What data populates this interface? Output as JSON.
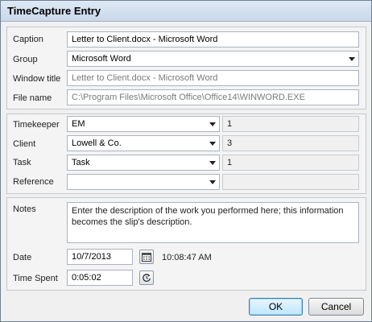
{
  "window": {
    "title": "TimeCapture Entry"
  },
  "info": {
    "caption_label": "Caption",
    "caption_value": "Letter to Client.docx - Microsoft Word",
    "group_label": "Group",
    "group_value": "Microsoft Word",
    "window_title_label": "Window title",
    "window_title_value": "Letter to Client.docx - Microsoft Word",
    "file_name_label": "File name",
    "file_name_value": "C:\\Program Files\\Microsoft Office\\Office14\\WINWORD.EXE"
  },
  "assign": {
    "timekeeper_label": "Timekeeper",
    "timekeeper_value": "EM",
    "timekeeper_id": "1",
    "client_label": "Client",
    "client_value": "Lowell & Co.",
    "client_id": "3",
    "task_label": "Task",
    "task_value": "Task",
    "task_id": "1",
    "reference_label": "Reference",
    "reference_value": "",
    "reference_id": ""
  },
  "details": {
    "notes_label": "Notes",
    "notes_value": "Enter the description of the work you performed here; this information becomes the slip's description.",
    "date_label": "Date",
    "date_value": "10/7/2013",
    "time_value": "10:08:47 AM",
    "time_spent_label": "Time Spent",
    "time_spent_value": "0:05:02"
  },
  "buttons": {
    "ok": "OK",
    "cancel": "Cancel"
  },
  "icons": {
    "calendar": "calendar-icon",
    "timer": "refresh-timer-icon",
    "dropdown": "chevron-down-icon"
  }
}
